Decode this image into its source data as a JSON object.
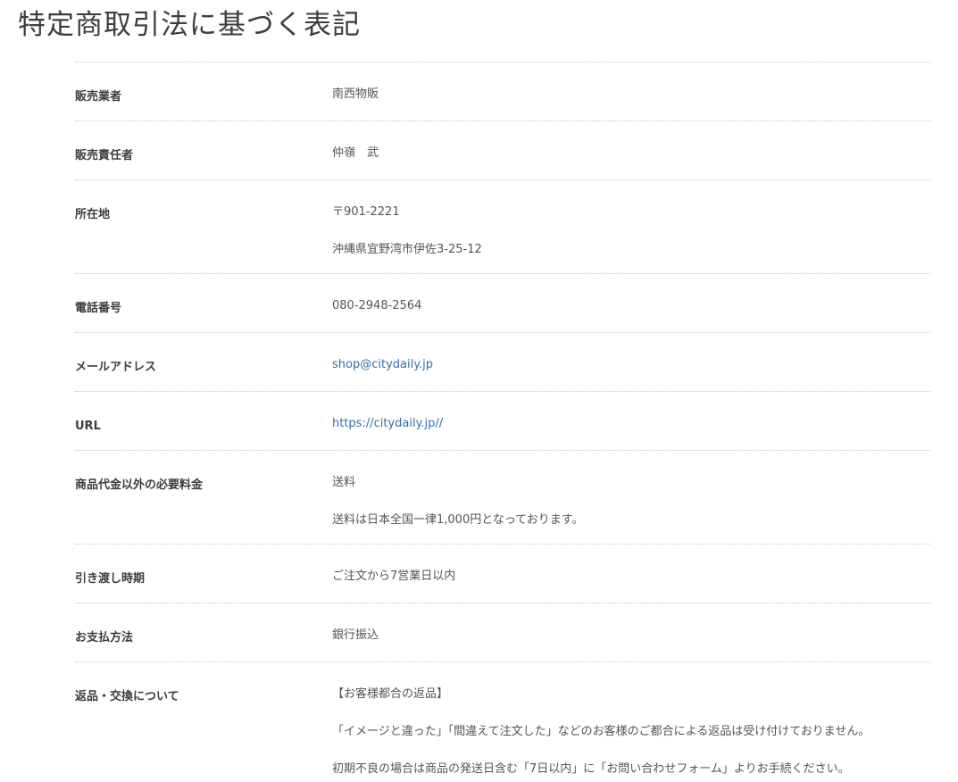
{
  "page": {
    "title": "特定商取引法に基づく表記"
  },
  "rows": [
    {
      "label": "販売業者",
      "lines": [
        "南西物販"
      ]
    },
    {
      "label": "販売責任者",
      "lines": [
        "仲嶺　武"
      ]
    },
    {
      "label": "所在地",
      "lines": [
        "〒901-2221",
        "沖縄県宜野湾市伊佐3-25-12"
      ]
    },
    {
      "label": "電話番号",
      "lines": [
        "080-2948-2564"
      ]
    },
    {
      "label": "メールアドレス",
      "lines": [
        "shop@citydaily.jp"
      ]
    },
    {
      "label": "URL",
      "lines": [
        "https://citydaily.jp//"
      ]
    },
    {
      "label": "商品代金以外の必要料金",
      "lines": [
        "送料",
        "送料は日本全国一律1,000円となっております。"
      ]
    },
    {
      "label": "引き渡し時期",
      "lines": [
        "ご注文から7営業日以内"
      ]
    },
    {
      "label": "お支払方法",
      "lines": [
        "銀行振込"
      ]
    },
    {
      "label": "返品・交換について",
      "lines": [
        "【お客様都合の返品】",
        "「イメージと違った」「間違えて注文した」などのお客様のご都合による返品は受け付けておりません。",
        "初期不良の場合は商品の発送日含む「7日以内」に「お問い合わせフォーム」よりお手続ください。"
      ]
    }
  ],
  "colors": {
    "link": "#3a6ea5",
    "text": "#333333",
    "divider": "#c8c8c8"
  }
}
